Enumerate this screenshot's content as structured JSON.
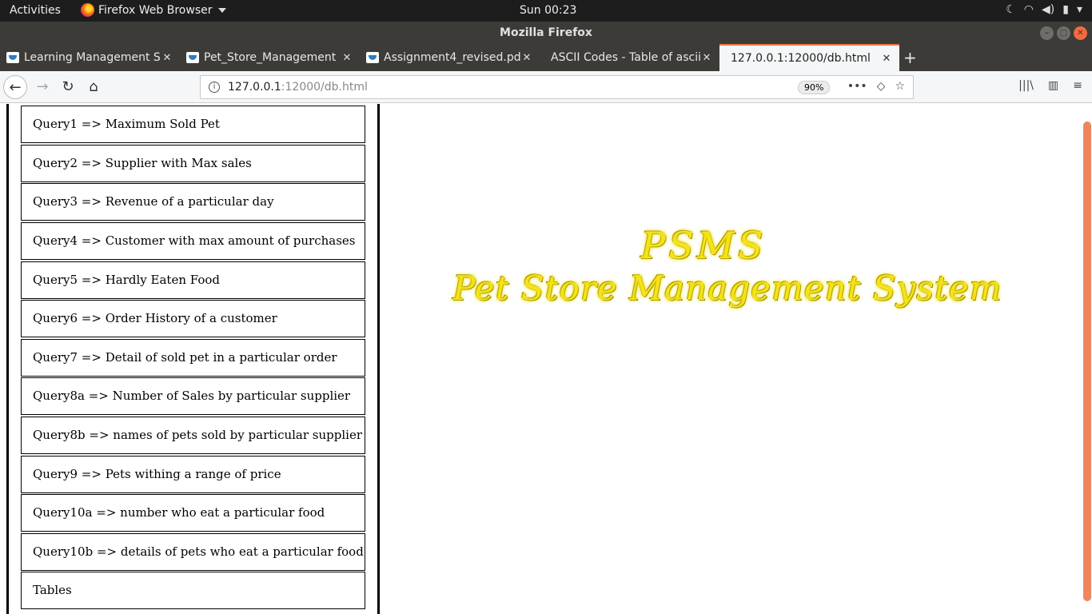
{
  "system": {
    "activities": "Activities",
    "app_menu": "Firefox Web Browser",
    "clock": "Sun 00:23",
    "tray_icons": [
      "moon-icon",
      "wifi-icon",
      "volume-icon",
      "battery-icon",
      "power-menu-icon"
    ]
  },
  "window": {
    "title": "Mozilla Firefox"
  },
  "tabs": [
    {
      "title": "Learning Management Sy",
      "favicon": "lms-favicon"
    },
    {
      "title": "Pet_Store_Management",
      "favicon": "lms-favicon"
    },
    {
      "title": "Assignment4_revised.pd",
      "favicon": "lms-favicon"
    },
    {
      "title": "ASCII Codes - Table of ascii c",
      "favicon": ""
    },
    {
      "title": "127.0.0.1:12000/db.html",
      "favicon": "",
      "active": true
    }
  ],
  "nav": {
    "url_host": "127.0.0.1",
    "url_rest": ":12000/db.html",
    "zoom": "90%"
  },
  "queries": [
    "Query1 => Maximum Sold Pet",
    "Query2 => Supplier with Max sales",
    "Query3 => Revenue of a particular day",
    "Query4 => Customer with max amount of purchases",
    "Query5 => Hardly Eaten Food",
    "Query6 => Order History of a customer",
    "Query7 => Detail of sold pet in a particular order",
    "Query8a => Number of Sales by particular supplier",
    "Query8b => names of pets sold by particular supplier",
    "Query9 => Pets withing a range of price",
    "Query10a => number who eat a particular food",
    "Query10b => details of pets who eat a particular food",
    "Tables"
  ],
  "logo": {
    "abbr": "PSMS",
    "full": "Pet Store Management System"
  },
  "colors": {
    "accent": "#f0734a",
    "logo_fill": "#f5e21a"
  }
}
